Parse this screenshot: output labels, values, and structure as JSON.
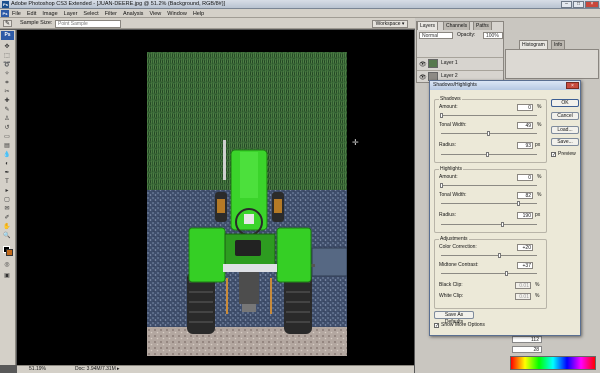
{
  "window": {
    "title": "Adobe Photoshop CS3 Extended - [JUAN-DEERE.jpg @ 51.2% (Background, RGB/8#)]",
    "app_icon": "Ps"
  },
  "menu": {
    "logo": "Ps",
    "items": [
      "File",
      "Edit",
      "Image",
      "Layer",
      "Select",
      "Filter",
      "Analysis",
      "View",
      "Window",
      "Help"
    ]
  },
  "options": {
    "sample_size_label": "Sample Size:",
    "sample_size_value": "Point Sample",
    "workspace_label": "Workspace"
  },
  "status": {
    "zoom": "51.19%",
    "doc": "Doc: 3.94M/7.31M"
  },
  "layers_panel": {
    "tabs": [
      "Layers",
      "Channels",
      "Paths"
    ],
    "blend_mode": "Normal",
    "opacity_label": "Opacity:",
    "opacity_value": "100%",
    "layers": [
      "Layer 1",
      "Layer 2"
    ]
  },
  "right_tabs": [
    "Histogram",
    "Info"
  ],
  "dialog": {
    "title": "Shadows/Highlights",
    "shadows": {
      "title": "Shadows",
      "amount_label": "Amount:",
      "amount": "0",
      "amount_unit": "%",
      "tonal_width_label": "Tonal Width:",
      "tonal_width": "49",
      "tonal_width_unit": "%",
      "radius_label": "Radius:",
      "radius": "93",
      "radius_unit": "px"
    },
    "highlights": {
      "title": "Highlights",
      "amount_label": "Amount:",
      "amount": "0",
      "amount_unit": "%",
      "tonal_width_label": "Tonal Width:",
      "tonal_width": "82",
      "tonal_width_unit": "%",
      "radius_label": "Radius:",
      "radius": "190",
      "radius_unit": "px"
    },
    "adjustments": {
      "title": "Adjustments",
      "color_correction_label": "Color Correction:",
      "color_correction": "+20",
      "midtone_contrast_label": "Midtone Contrast:",
      "midtone_contrast": "+37",
      "black_clip_label": "Black Clip:",
      "black_clip": "0.01",
      "black_clip_unit": "%",
      "white_clip_label": "White Clip:",
      "white_clip": "0.01",
      "white_clip_unit": "%"
    },
    "buttons": {
      "ok": "OK",
      "cancel": "Cancel",
      "load": "Load...",
      "save": "Save...",
      "preview": "Preview",
      "save_defaults": "Save As Defaults",
      "show_more": "Show More Options"
    },
    "bg_values": [
      "112",
      "28"
    ]
  },
  "colors": {
    "accent": "#0a246a",
    "tractor_green": "#3bd12b",
    "gravel": "#4a5a7a",
    "grass": "#2e5b2e"
  }
}
